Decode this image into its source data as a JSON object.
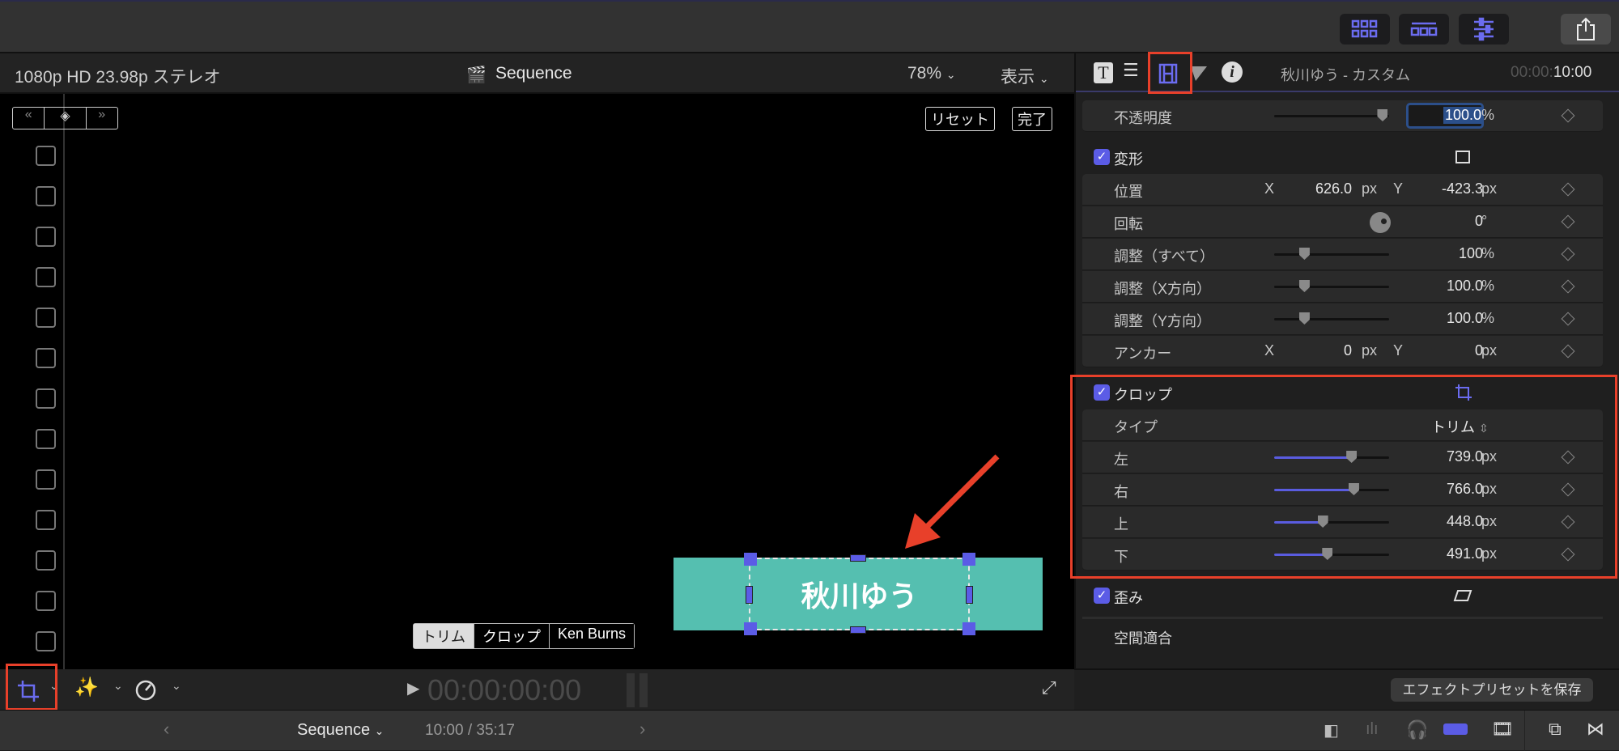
{
  "viewer": {
    "format": "1080p HD 23.98p ステレオ",
    "title": "Sequence",
    "zoom": "78%",
    "view_menu": "表示",
    "reset": "リセット",
    "done": "完了",
    "modes": [
      "トリム",
      "クロップ",
      "Ken Burns"
    ],
    "active_mode": "トリム",
    "title_text": "秋川ゆう",
    "timecode": "00:00:00:00",
    "title_color": "#55bfb0"
  },
  "bottom": {
    "sequence": "Sequence",
    "time": "10:00 / 35:17"
  },
  "inspector": {
    "clip_name": "秋川ゆう - カスタム",
    "duration_dim": "00:00:",
    "duration": "10:00",
    "opacity": {
      "label": "不透明度",
      "value": "100.0",
      "unit": "%",
      "slider": 0.94
    },
    "transform": {
      "label": "変形",
      "position": {
        "label": "位置",
        "x_label": "X",
        "x": "626.0",
        "y_label": "Y",
        "y": "-423.3",
        "unit": "px"
      },
      "rotation": {
        "label": "回転",
        "value": "0",
        "unit": "°"
      },
      "scale_all": {
        "label": "調整（すべて）",
        "value": "100",
        "unit": "%",
        "slider": 0.26
      },
      "scale_x": {
        "label": "調整（X方向）",
        "value": "100.0",
        "unit": "%",
        "slider": 0.26
      },
      "scale_y": {
        "label": "調整（Y方向）",
        "value": "100.0",
        "unit": "%",
        "slider": 0.26
      },
      "anchor": {
        "label": "アンカー",
        "x_label": "X",
        "x": "0",
        "y_label": "Y",
        "y": "0",
        "unit": "px"
      }
    },
    "crop": {
      "label": "クロップ",
      "type": {
        "label": "タイプ",
        "value": "トリム"
      },
      "left": {
        "label": "左",
        "value": "739.0",
        "unit": "px",
        "slider": 0.67
      },
      "right": {
        "label": "右",
        "value": "766.0",
        "unit": "px",
        "slider": 0.69
      },
      "top": {
        "label": "上",
        "value": "448.0",
        "unit": "px",
        "slider": 0.42
      },
      "bottom": {
        "label": "下",
        "value": "491.0",
        "unit": "px",
        "slider": 0.46
      }
    },
    "distort": {
      "label": "歪み"
    },
    "spatial": {
      "label": "空間適合"
    },
    "save_preset": "エフェクトプリセットを保存"
  },
  "colors": {
    "accent": "#5b5ce6",
    "highlight": "#e8402a"
  }
}
